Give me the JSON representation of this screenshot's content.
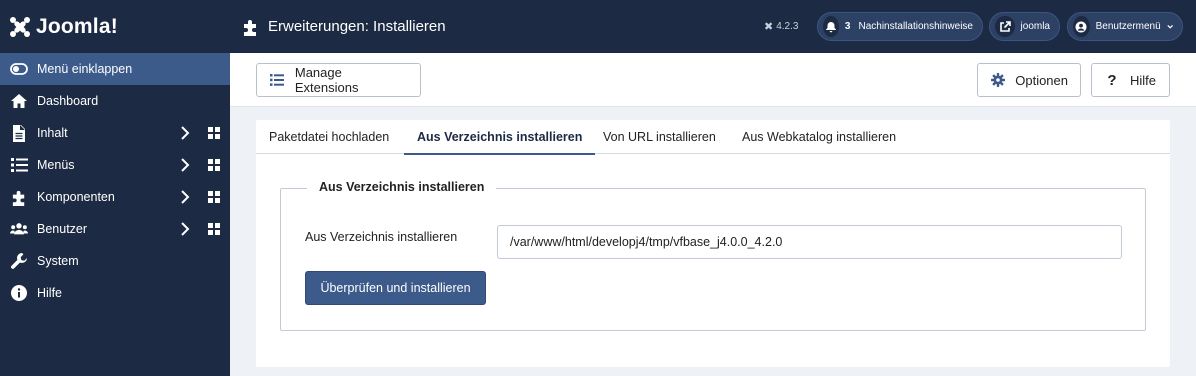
{
  "brand": {
    "name": "Joomla!"
  },
  "header": {
    "title": "Erweiterungen: Installieren",
    "version": "4.2.3",
    "notifications": {
      "count": "3",
      "label": "Nachinstallationshinweise"
    },
    "site_link": "joomla",
    "user_menu": "Benutzermenü"
  },
  "sidebar": {
    "collapse": "Menü einklappen",
    "items": [
      {
        "label": "Dashboard",
        "icon": "home-icon"
      },
      {
        "label": "Inhalt",
        "icon": "file-icon"
      },
      {
        "label": "Menüs",
        "icon": "list-icon"
      },
      {
        "label": "Komponenten",
        "icon": "puzzle-icon"
      },
      {
        "label": "Benutzer",
        "icon": "users-icon"
      },
      {
        "label": "System",
        "icon": "wrench-icon"
      },
      {
        "label": "Hilfe",
        "icon": "info-icon"
      }
    ]
  },
  "toolbar": {
    "manage": "Manage Extensions",
    "options": "Optionen",
    "help": "Hilfe"
  },
  "tabs": [
    "Paketdatei hochladen",
    "Aus Verzeichnis installieren",
    "Von URL installieren",
    "Aus Webkatalog installieren"
  ],
  "form": {
    "legend": "Aus Verzeichnis installieren",
    "label": "Aus Verzeichnis installieren",
    "value": "/var/www/html/developj4/tmp/vfbase_j4.0.0_4.2.0",
    "submit": "Überprüfen und installieren"
  },
  "colors": {
    "header_bg": "#1c2a43",
    "accent": "#3c5a8a"
  }
}
